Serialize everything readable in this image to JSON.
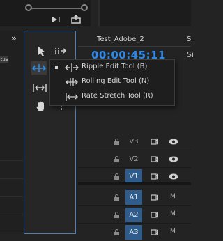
{
  "sequence": {
    "title": "Test_Adobe_2",
    "more": "S",
    "timecode": "00:00:45:11",
    "si_label": "Si"
  },
  "left_panel": {
    "chevron": "»",
    "badge": "tuv"
  },
  "tools": [
    {
      "name": "selection-tool",
      "icon": "arrow-icon"
    },
    {
      "name": "track-select-tool",
      "icon": "track-select-icon"
    },
    {
      "name": "ripple-edit-tool",
      "icon": "ripple-edit-icon",
      "active": true
    },
    {
      "name": "razor-tool",
      "icon": "razor-icon"
    },
    {
      "name": "slip-tool",
      "icon": "slip-icon"
    },
    {
      "name": "pen-tool",
      "icon": "pen-icon"
    },
    {
      "name": "hand-tool",
      "icon": "hand-icon"
    },
    {
      "name": "type-tool",
      "icon": "type-icon"
    }
  ],
  "context_menu": {
    "items": [
      {
        "label": "Ripple Edit Tool (B)",
        "checked": true,
        "icon": "ripple-edit-icon"
      },
      {
        "label": "Rolling Edit Tool (N)",
        "checked": false,
        "icon": "rolling-edit-icon"
      },
      {
        "label": "Rate Stretch Tool (R)",
        "checked": false,
        "icon": "rate-stretch-icon"
      }
    ]
  },
  "tracks": [
    {
      "name": "V3",
      "kind": "video",
      "targeted": false,
      "toggle": "eye-icon"
    },
    {
      "name": "V2",
      "kind": "video",
      "targeted": false,
      "toggle": "eye-icon"
    },
    {
      "name": "V1",
      "kind": "video",
      "targeted": true,
      "toggle": "eye-icon"
    },
    {
      "name": "A1",
      "kind": "audio",
      "targeted": true,
      "toggle": "M"
    },
    {
      "name": "A2",
      "kind": "audio",
      "targeted": true,
      "toggle": "M"
    },
    {
      "name": "A3",
      "kind": "audio",
      "targeted": true,
      "toggle": "M"
    }
  ],
  "colors": {
    "accent": "#2d8ceb",
    "panel_border": "#4d7fb8",
    "track_selected": "#2f5c8a"
  }
}
